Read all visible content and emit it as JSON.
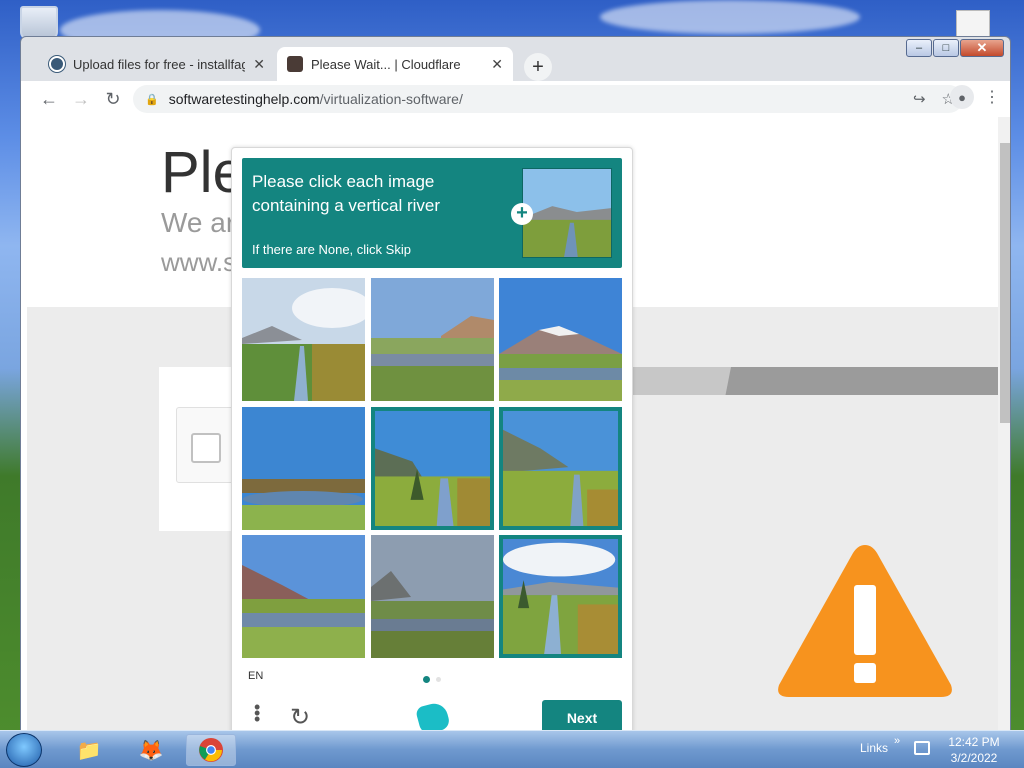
{
  "browser": {
    "tabs": [
      {
        "title": "Upload files for free - installfagc"
      },
      {
        "title": "Please Wait... | Cloudflare"
      }
    ],
    "url_domain": "softwaretestinghelp.com",
    "url_path": "/virtualization-software/"
  },
  "page": {
    "title": "Ple",
    "line1": "We ar",
    "line2": "www.s"
  },
  "captcha": {
    "prompt_line1": "Please click each image",
    "prompt_line2": "containing a vertical river",
    "prompt_hint": "If there are None, click Skip",
    "tiles": [
      {
        "selected": false
      },
      {
        "selected": false
      },
      {
        "selected": false
      },
      {
        "selected": false
      },
      {
        "selected": true
      },
      {
        "selected": true
      },
      {
        "selected": false
      },
      {
        "selected": false
      },
      {
        "selected": true
      }
    ],
    "language": "EN",
    "next_label": "Next"
  },
  "taskbar": {
    "links_label": "Links",
    "time": "12:42 PM",
    "date": "3/2/2022"
  },
  "colors": {
    "accent": "#148580",
    "warning": "#f7931e"
  }
}
